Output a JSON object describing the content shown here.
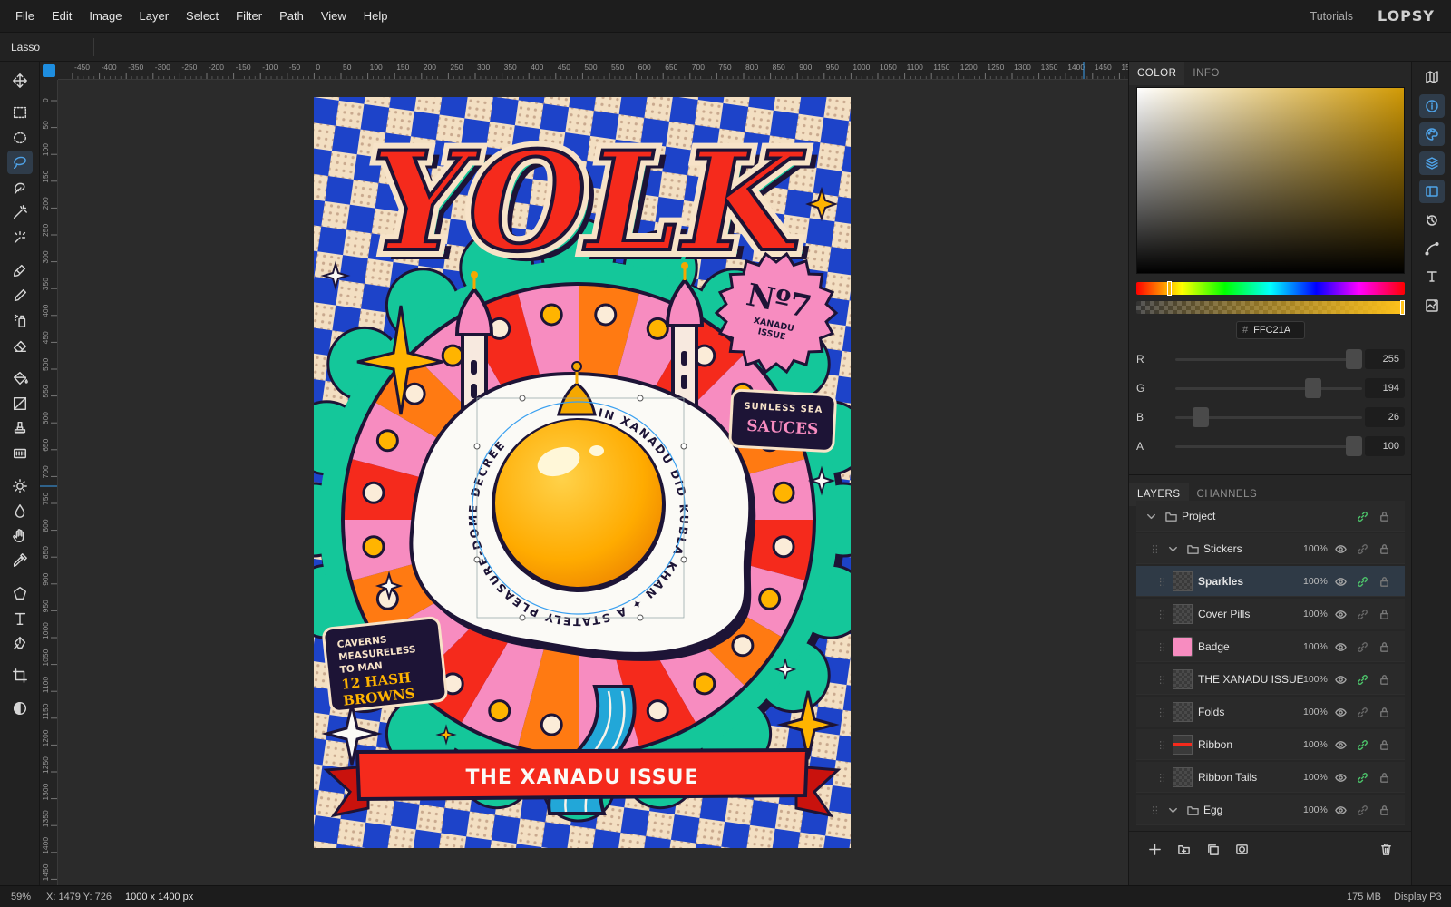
{
  "menu": {
    "items": [
      "File",
      "Edit",
      "Image",
      "Layer",
      "Select",
      "Filter",
      "Path",
      "View",
      "Help"
    ],
    "tutorials": "Tutorials",
    "logo": "LOPSY"
  },
  "options": {
    "tool_name": "Lasso"
  },
  "ruler": {
    "h_labels": [
      "-450",
      "-400",
      "-350",
      "-300",
      "-250",
      "-200",
      "-150",
      "-100",
      "-50",
      "0",
      "50",
      "100",
      "150",
      "200",
      "250",
      "300",
      "350",
      "400",
      "450",
      "500",
      "550",
      "600",
      "650",
      "700",
      "750",
      "800",
      "850",
      "900",
      "950",
      "1000",
      "1050",
      "1100",
      "1150",
      "1200",
      "1250",
      "1300",
      "1350",
      "1400",
      "1450",
      "15"
    ],
    "v_labels": [
      "0",
      "50",
      "100",
      "150",
      "200",
      "250",
      "300",
      "350",
      "400",
      "450",
      "500",
      "550",
      "600",
      "650",
      "700",
      "750",
      "800",
      "850",
      "900",
      "950",
      "1000",
      "1050",
      "1100",
      "1150",
      "1200",
      "1250",
      "1300",
      "1350",
      "1400",
      "1450"
    ]
  },
  "poster": {
    "title": "YOLK",
    "badge_no": "Nº7",
    "badge_line1": "XANADU",
    "badge_line2": "ISSUE",
    "sauce_top": "SUNLESS SEA",
    "sauce_main": "SAUCES",
    "ring_text": "IN XANADU DID KUBLA KHAN ✦ A STATELY PLEASURE-DOME DECREE",
    "caverns": [
      "CAVERNS",
      "MEASURELESS",
      "TO MAN"
    ],
    "hash": [
      "12 HASH",
      "BROWNS"
    ],
    "ribbon": "THE XANADU ISSUE",
    "colors": {
      "red": "#f52a1c",
      "blue": "#1d43c9",
      "cream": "#f7e3c8",
      "teal": "#14c79a",
      "pink": "#f78cc0",
      "orange": "#ff7a12",
      "yolk": "#ffb400",
      "navy": "#1d1436"
    }
  },
  "panel": {
    "tabs": [
      "COLOR",
      "INFO"
    ],
    "hex_label": "#",
    "hex": "FFC21A",
    "channels": [
      {
        "label": "R",
        "value": "255",
        "fraction": 1.0
      },
      {
        "label": "G",
        "value": "194",
        "fraction": 0.76
      },
      {
        "label": "B",
        "value": "26",
        "fraction": 0.1
      },
      {
        "label": "A",
        "value": "100",
        "fraction": 1.0
      }
    ]
  },
  "layers": {
    "tabs": [
      "LAYERS",
      "CHANNELS"
    ],
    "rows": [
      {
        "name": "Project",
        "opacity": "",
        "type": "group",
        "depth": 0,
        "expanded": true,
        "selected": false,
        "linked": true,
        "visible": false
      },
      {
        "name": "Stickers",
        "opacity": "100%",
        "type": "group",
        "depth": 1,
        "expanded": true,
        "selected": false,
        "linked": false,
        "visible": true
      },
      {
        "name": "Sparkles",
        "opacity": "100%",
        "type": "layer",
        "depth": 2,
        "selected": true,
        "linked": true,
        "visible": true
      },
      {
        "name": "Cover Pills",
        "opacity": "100%",
        "type": "layer",
        "depth": 2,
        "selected": false,
        "linked": false,
        "visible": true
      },
      {
        "name": "Badge",
        "opacity": "100%",
        "type": "layer",
        "depth": 2,
        "selected": false,
        "linked": false,
        "visible": true,
        "thumb": "badge"
      },
      {
        "name": "THE XANADU ISSUE",
        "opacity": "100%",
        "type": "layer",
        "depth": 2,
        "selected": false,
        "linked": true,
        "visible": true
      },
      {
        "name": "Folds",
        "opacity": "100%",
        "type": "layer",
        "depth": 2,
        "selected": false,
        "linked": false,
        "visible": true
      },
      {
        "name": "Ribbon",
        "opacity": "100%",
        "type": "layer",
        "depth": 2,
        "selected": false,
        "linked": true,
        "visible": true,
        "thumb": "ribbon"
      },
      {
        "name": "Ribbon Tails",
        "opacity": "100%",
        "type": "layer",
        "depth": 2,
        "selected": false,
        "linked": true,
        "visible": true
      },
      {
        "name": "Egg",
        "opacity": "100%",
        "type": "group",
        "depth": 1,
        "expanded": true,
        "selected": false,
        "linked": false,
        "visible": true
      }
    ]
  },
  "status": {
    "zoom": "59%",
    "coords": "X: 1479 Y: 726",
    "size": "1000 x 1400 px",
    "memory": "175 MB",
    "profile": "Display P3"
  }
}
